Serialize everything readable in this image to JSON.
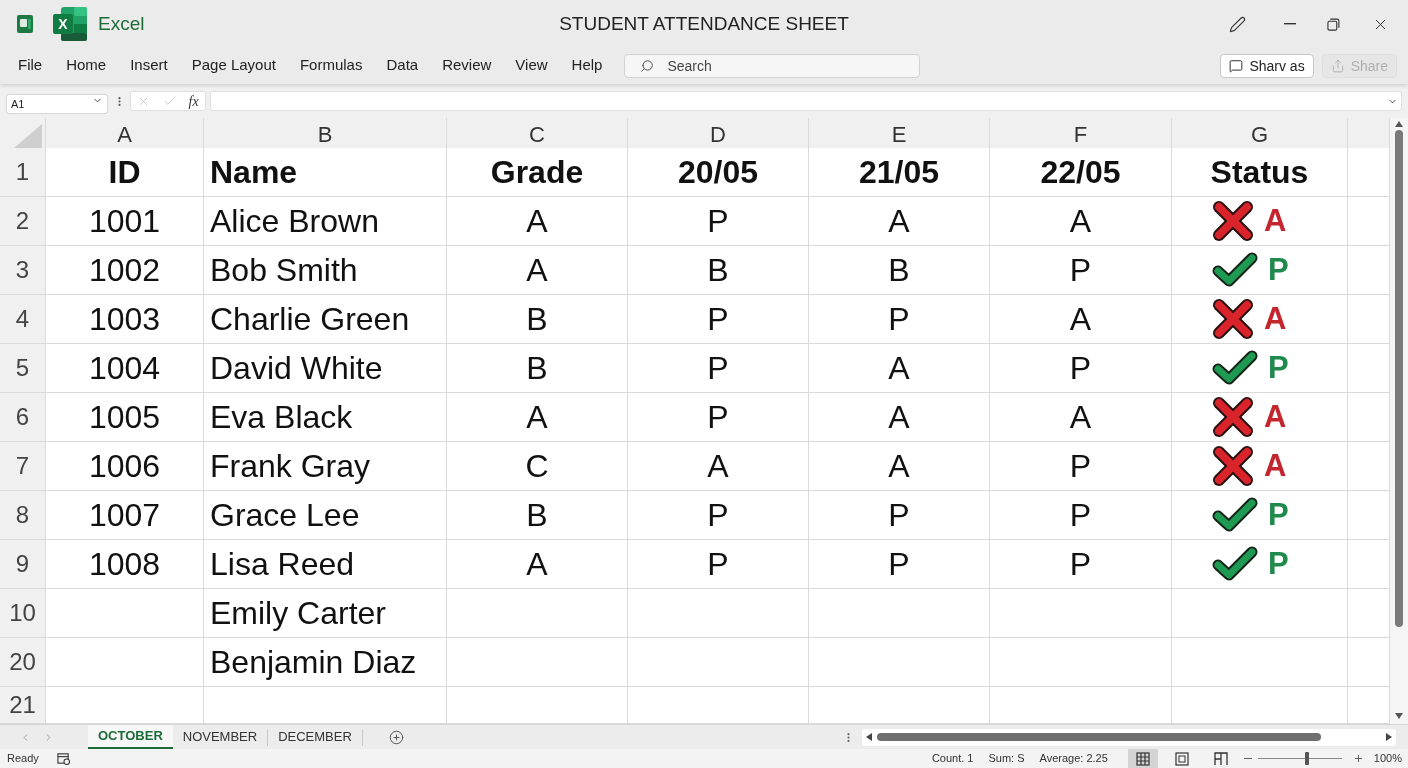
{
  "app": {
    "name": "Excel",
    "logo_letter": "X"
  },
  "window": {
    "title": "STUDENT ATTENDANCE SHEET"
  },
  "ribbon_tabs": [
    {
      "label": "File",
      "selected": false
    },
    {
      "label": "Home",
      "selected": false
    },
    {
      "label": "Insert",
      "selected": false
    },
    {
      "label": "Page Layout",
      "selected": false
    },
    {
      "label": "Formulas",
      "selected": false
    },
    {
      "label": "Data",
      "selected": false
    },
    {
      "label": "Review",
      "selected": false
    },
    {
      "label": "View",
      "selected": false
    },
    {
      "label": "Help",
      "selected": false
    }
  ],
  "search": {
    "placeholder": "Search"
  },
  "buttons": [
    {
      "kind": "comments",
      "label": "Sharv as",
      "disabled": false
    },
    {
      "kind": "share",
      "label": "Share",
      "disabled": true
    }
  ],
  "formula_bar": {
    "name_box": "A1",
    "function_label": "fx"
  },
  "columns": [
    "A",
    "B",
    "C",
    "D",
    "E",
    "F",
    "G"
  ],
  "header_row": {
    "row_label": "1",
    "cells": [
      "ID",
      "Name",
      "Grade",
      "20/05",
      "21/05",
      "22/05",
      "Status"
    ]
  },
  "rows": [
    {
      "row_label": "2",
      "id": "1001",
      "name": "Alice Brown",
      "grade": "A",
      "days": [
        "P",
        "A",
        "A"
      ],
      "status": {
        "kind": "absent",
        "text": "A"
      }
    },
    {
      "row_label": "3",
      "id": "1002",
      "name": "Bob Smith",
      "grade": "A",
      "days": [
        "B",
        "B",
        "P"
      ],
      "status": {
        "kind": "present",
        "text": "P"
      }
    },
    {
      "row_label": "4",
      "id": "1003",
      "name": "Charlie Green",
      "grade": "B",
      "days": [
        "P",
        "P",
        "A"
      ],
      "status": {
        "kind": "absent",
        "text": "A"
      }
    },
    {
      "row_label": "5",
      "id": "1004",
      "name": "David White",
      "grade": "B",
      "days": [
        "P",
        "A",
        "P"
      ],
      "status": {
        "kind": "present",
        "text": "P"
      }
    },
    {
      "row_label": "6",
      "id": "1005",
      "name": "Eva Black",
      "grade": "A",
      "days": [
        "P",
        "A",
        "A"
      ],
      "status": {
        "kind": "absent",
        "text": "A"
      }
    },
    {
      "row_label": "7",
      "id": "1006",
      "name": "Frank Gray",
      "grade": "C",
      "days": [
        "A",
        "A",
        "P"
      ],
      "status": {
        "kind": "absent",
        "text": "A"
      }
    },
    {
      "row_label": "8",
      "id": "1007",
      "name": "Grace Lee",
      "grade": "B",
      "days": [
        "P",
        "P",
        "P"
      ],
      "status": {
        "kind": "present",
        "text": "P"
      }
    },
    {
      "row_label": "9",
      "id": "1008",
      "name": "Lisa Reed",
      "grade": "A",
      "days": [
        "P",
        "P",
        "P"
      ],
      "status": {
        "kind": "present",
        "text": "P"
      }
    },
    {
      "row_label": "10",
      "name": "Emily Carter"
    },
    {
      "row_label": "20",
      "name": "Benjamin Diaz"
    },
    {
      "row_label": "21"
    }
  ],
  "sheet_tabs": [
    {
      "label": "OCTOBER",
      "selected": true
    },
    {
      "label": "NOVEMBER",
      "selected": false
    },
    {
      "label": "DECEMBER",
      "selected": false
    }
  ],
  "status_bar": {
    "mode": "Ready",
    "summary": [
      "Count. 1",
      "Sum: S",
      "Average: 2.25"
    ],
    "views": [
      {
        "kind": "normal",
        "selected": true
      },
      {
        "kind": "page_layout",
        "selected": false
      },
      {
        "kind": "page_break",
        "selected": false
      }
    ],
    "zoom": {
      "level": 0.58,
      "reading": "100%"
    }
  }
}
